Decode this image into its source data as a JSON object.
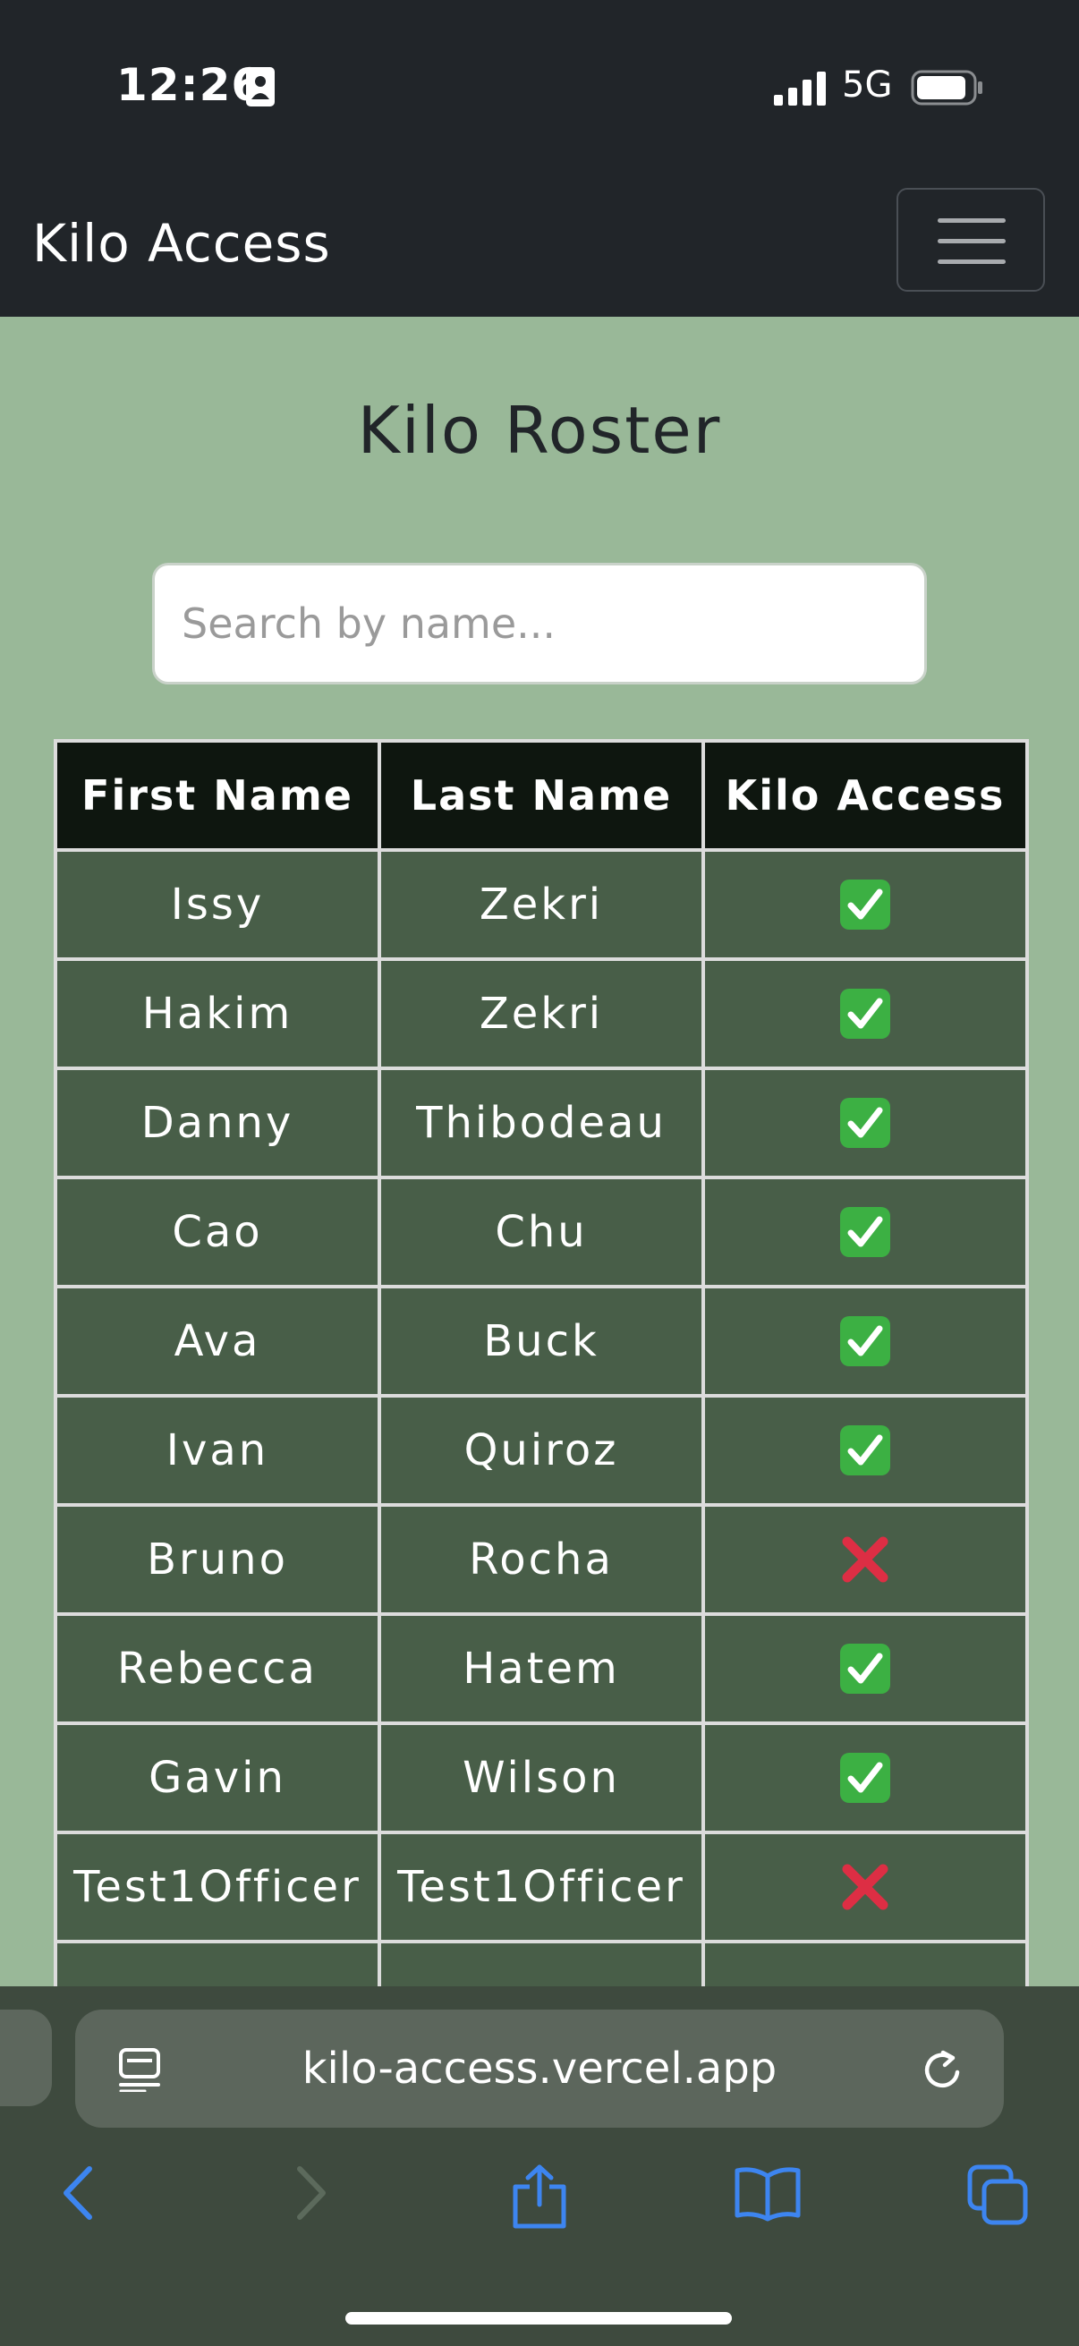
{
  "status_bar": {
    "time": "12:26",
    "network": "5G"
  },
  "navbar": {
    "brand": "Kilo Access"
  },
  "main": {
    "title": "Kilo Roster",
    "search": {
      "placeholder": "Search by name...",
      "value": ""
    },
    "table": {
      "headers": [
        "First Name",
        "Last Name",
        "Kilo Access"
      ],
      "rows": [
        {
          "first": "Issy",
          "last": "Zekri",
          "access": true
        },
        {
          "first": "Hakim",
          "last": "Zekri",
          "access": true
        },
        {
          "first": "Danny",
          "last": "Thibodeau",
          "access": true
        },
        {
          "first": "Cao",
          "last": "Chu",
          "access": true
        },
        {
          "first": "Ava",
          "last": "Buck",
          "access": true
        },
        {
          "first": "Ivan",
          "last": "Quiroz",
          "access": true
        },
        {
          "first": "Bruno",
          "last": "Rocha",
          "access": false
        },
        {
          "first": "Rebecca",
          "last": "Hatem",
          "access": true
        },
        {
          "first": "Gavin",
          "last": "Wilson",
          "access": true
        },
        {
          "first": "Test1Officer",
          "last": "Test1Officer",
          "access": false
        }
      ]
    },
    "access_icons": {
      "granted": "check-mark-icon",
      "denied": "cross-mark-icon"
    },
    "colors": {
      "page_background": "#99b898",
      "navbar": "#212529",
      "table_header": "#0e160f",
      "table_cell": "#485e48",
      "granted": "#3cb043",
      "denied": "#dd2e44"
    }
  },
  "browser": {
    "url": "kilo-access.vercel.app",
    "icons": [
      "page-menu-icon",
      "reload-icon",
      "back-icon",
      "forward-icon",
      "share-icon",
      "bookmarks-icon",
      "tabs-icon"
    ]
  }
}
